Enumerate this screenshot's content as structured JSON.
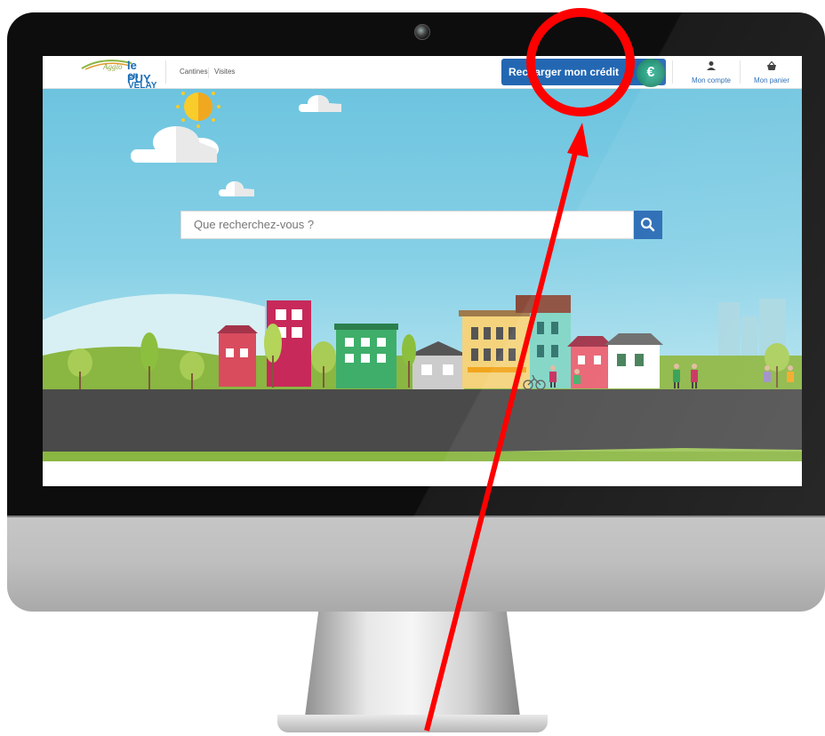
{
  "header": {
    "logo": {
      "small_text": "Agglo",
      "main_text": "le PUY",
      "sub_text": "en VELAY"
    },
    "nav": [
      {
        "label": "Cantines"
      },
      {
        "label": "Visites"
      }
    ],
    "recharge_button": {
      "label": "Recharger mon crédit"
    },
    "credit_icon_symbol": "€",
    "account": {
      "label": "Mon compte",
      "icon": "user-icon"
    },
    "cart": {
      "label": "Mon panier",
      "icon": "basket-icon"
    }
  },
  "search": {
    "placeholder": "Que recherchez-vous ?",
    "icon": "search-icon"
  },
  "colors": {
    "brand_blue": "#2367b3",
    "sky": "#6dc4df",
    "road": "#4a4a4a",
    "grass": "#8ab642",
    "annotation_red": "#ff0000"
  }
}
